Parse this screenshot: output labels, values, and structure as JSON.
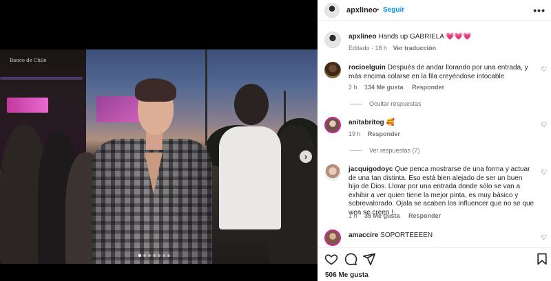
{
  "post": {
    "username": "apxlineo",
    "separator": "•",
    "follow_label": "Seguir",
    "more_label": "•••",
    "caption_username": "apxlineo",
    "caption_text": "Hands up GABRIELA 💗💗💗",
    "caption_meta_edited": "Editado · 18 h",
    "caption_translate": "Ver traducción",
    "carousel_dots": 7,
    "carousel_active": 1,
    "photo_overlay_text": "Banco de Chile"
  },
  "comments": [
    {
      "username": "rocioelguin",
      "text": "Después de andar llorando por una entrada, y más encima colarse en la fila creyéndose intocable",
      "time": "2 h",
      "likes": "134 Me gusta",
      "reply": "Responder",
      "replies_toggle": "Ocultar respuestas"
    },
    {
      "username": "anitabritog",
      "text": "🥰",
      "time": "19 h",
      "reply": "Responder",
      "replies_toggle": "Ver respuestas (7)"
    },
    {
      "username": "jacquigodoyc",
      "text": "Que penca mostrarse de una forma y actuar de una tan distinta. Eso está bien alejado de ser un buen hijo de Dios. Llorar por una entrada donde sólo se van a exhibir a ver quien tiene la mejor pinta, es muy básico y sobrevalorado. Ojala se acaben los influencer que no se que wea se creen !",
      "time": "1 h",
      "likes": "35 Me gusta",
      "reply": "Responder"
    },
    {
      "username": "amaccire",
      "text": "SOPORTEEEEN"
    }
  ],
  "actions": {
    "likes_count": "506 Me gusta"
  },
  "icons": {
    "next": "chevron-right-icon",
    "like": "heart-icon",
    "comment": "comment-icon",
    "share": "share-icon",
    "save": "bookmark-icon"
  },
  "colors": {
    "link_blue": "#0095f6",
    "text": "#262626",
    "muted": "#737373"
  }
}
